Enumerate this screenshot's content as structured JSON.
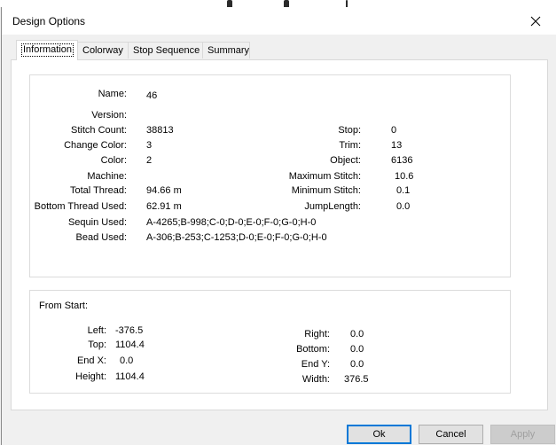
{
  "dialog": {
    "title": "Design Options"
  },
  "tabs": [
    {
      "label": "Information"
    },
    {
      "label": "Colorway"
    },
    {
      "label": "Stop Sequence"
    },
    {
      "label": "Summary"
    }
  ],
  "info": {
    "name_label": "Name:",
    "name_value": "46",
    "version_label": "Version:",
    "version_value": "",
    "stitch_count_label": "Stitch Count:",
    "stitch_count_value": "38813",
    "change_color_label": "Change Color:",
    "change_color_value": "3",
    "color_label": "Color:",
    "color_value": "2",
    "machine_label": "Machine:",
    "machine_value": "",
    "total_thread_label": "Total Thread:",
    "total_thread_value": "94.66 m",
    "bottom_thread_label": "Bottom Thread Used:",
    "bottom_thread_value": "62.91 m",
    "sequin_label": "Sequin Used:",
    "sequin_value": "A-4265;B-998;C-0;D-0;E-0;F-0;G-0;H-0",
    "bead_label": "Bead Used:",
    "bead_value": "A-306;B-253;C-1253;D-0;E-0;F-0;G-0;H-0",
    "stop_label": "Stop:",
    "stop_value": "0",
    "trim_label": "Trim:",
    "trim_value": "13",
    "object_label": "Object:",
    "object_value": "6136",
    "max_stitch_label": "Maximum Stitch:",
    "max_stitch_value": "10.6",
    "min_stitch_label": "Minimum Stitch:",
    "min_stitch_value": "0.1",
    "jump_length_label": "JumpLength:",
    "jump_length_value": "0.0"
  },
  "from_start": {
    "heading": "From Start:",
    "left_label": "Left:",
    "left_value": "-376.5",
    "top_label": "Top:",
    "top_value": "1104.4",
    "endx_label": "End X:",
    "endx_value": "0.0",
    "height_label": "Height:",
    "height_value": "1104.4",
    "right_label": "Right:",
    "right_value": "0.0",
    "bottom_label": "Bottom:",
    "bottom_value": "0.0",
    "endy_label": "End Y:",
    "endy_value": "0.0",
    "width_label": "Width:",
    "width_value": "376.5"
  },
  "buttons": {
    "ok": "Ok",
    "cancel": "Cancel",
    "apply": "Apply"
  }
}
